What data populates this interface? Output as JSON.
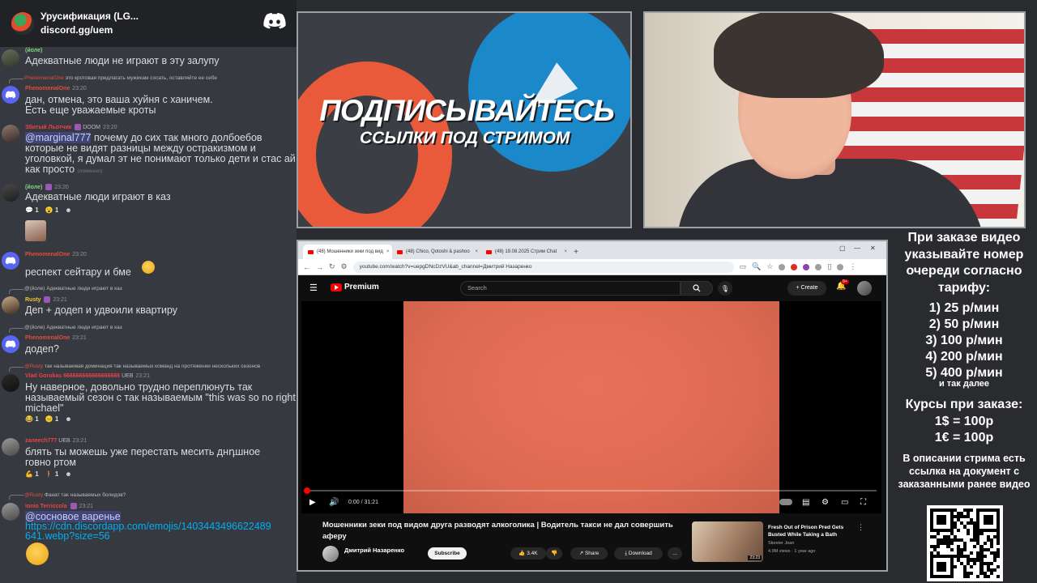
{
  "discord": {
    "server_name": "Урусификация (LG...",
    "invite": "discord.gg/uem",
    "messages": [
      {
        "text": "Адекватные люди не играют в эту залупу",
        "meta": "(йоле)"
      },
      {
        "reply_user": "PhenomenalOne",
        "reply_text": "это кротовая предлагать мужикам сосать, оставляйте ее себе",
        "user": "PhenomenalOne",
        "time": "23:20",
        "lines": [
          "дан, отмена, это ваша хуйня с ханичем.",
          "Есть еще уважаемые кроты"
        ]
      },
      {
        "user": "Збитый Льотчик",
        "tag": "DOOM",
        "time": "23:20",
        "mention": "@marginal777",
        "text": " почему до сих так много долбоебов которые не видят разницы между остракизмом и уголовкой, я думал эт не понимают только дети и стас ай как просто",
        "edited": "(изменено)"
      },
      {
        "user": "(йоле)",
        "time": "23:20",
        "text": "Адекватные люди играют в каз",
        "reactions": [
          "1",
          "1"
        ]
      },
      {
        "user": "PhenomenalOne",
        "time": "23:20",
        "text": "респект сейтару и бме"
      },
      {
        "reply_user": "@(йоле)",
        "reply_text": "Адекватные люди играют в каз",
        "user": "Rusty",
        "time": "23:21",
        "text": "Деп + додеп и удвоили квартиру"
      },
      {
        "reply_user": "@(йоле)",
        "reply_text": "Адекватные люди играют в каз",
        "user": "PhenomenalOne",
        "time": "23:21",
        "text": "додеп?"
      },
      {
        "reply_user": "@Rusty",
        "reply_text": "так называемая доминация так называемых команд на протяжении нескольких сезонов",
        "user": "Vlad Gorokas 666666666666666666",
        "tag": "UEB",
        "time": "23:21",
        "text": "Ну наверное, довольно трудно переплюнуть так называемый сезон с так называемым \"this was so no right, michael\"",
        "reactions": [
          "1",
          "1"
        ]
      },
      {
        "user": "zaneech777",
        "tag": "UEB",
        "time": "23:21",
        "lines": [
          "блять ты можешь уже перестать месить днդшное",
          "говно ртом"
        ],
        "reactions": [
          "1",
          "1"
        ]
      },
      {
        "reply_user": "@Rusty",
        "reply_text": "Фанат так называемых болидов?",
        "user": "Ionio Terriccola",
        "time": "23:21",
        "mention": "@сосновое варенье",
        "link_lines": [
          "https://cdn.discordapp.com/emojis/1403443496622489",
          "641.webp?size=56"
        ]
      }
    ]
  },
  "promo": {
    "title": "ПОДПИСЫВАЙТЕСЬ",
    "subtitle": "ССЫЛКИ ПОД СТРИМОМ"
  },
  "browser": {
    "tabs": [
      "(48) Мошенники зеки под вид",
      "(48) Chico, Qotoshi & pashoo",
      "(48) 19.08.2025 Стрим Chat"
    ],
    "url": "youtube.com/watch?v=uepgDNcDzVU&ab_channel=Дмитрий Назаренко",
    "yt": {
      "brand": "Premium",
      "search_placeholder": "Search",
      "create": "Create",
      "notif_count": "9+"
    },
    "player": {
      "time": "0:00 / 31:21",
      "progress": 0.005
    },
    "video": {
      "title": "Мошенники зеки под видом друга разводят алкоголика | Водитель такси не дал совершить аферу",
      "channel": "Дмитрий Назаренко",
      "subscribe": "Subscribe",
      "likes": "3.4K",
      "share": "Share",
      "download": "Download",
      "more": "..."
    },
    "recommended": {
      "title": "Fresh Out of Prison Pred Gets Busted While Taking a Bath",
      "channel": "Skeeter Jean",
      "stats": "4.9M views · 1 year ago",
      "duration": "23:23"
    }
  },
  "info": {
    "intro": "При заказе видео указывайте номер очереди согласно тарифу:",
    "tariffs": [
      "1) 25 р/мин",
      "2) 50 р/мин",
      "3) 100 р/мин",
      "4) 200 р/мин",
      "5) 400 р/мин"
    ],
    "etc": "и так далее",
    "courses": "Курсы при заказе:",
    "rates": [
      "1$ = 100р",
      "1€ = 100р"
    ],
    "desc": "В описании стрима есть ссылка на документ с заказанными ранее видео"
  },
  "colors": {
    "discord_bg": "#36393f",
    "yt_red": "#ff0000",
    "video_orange": "#e36d55",
    "telegram_blue": "#1a88c9",
    "patreon_orange": "#e85a3a"
  }
}
